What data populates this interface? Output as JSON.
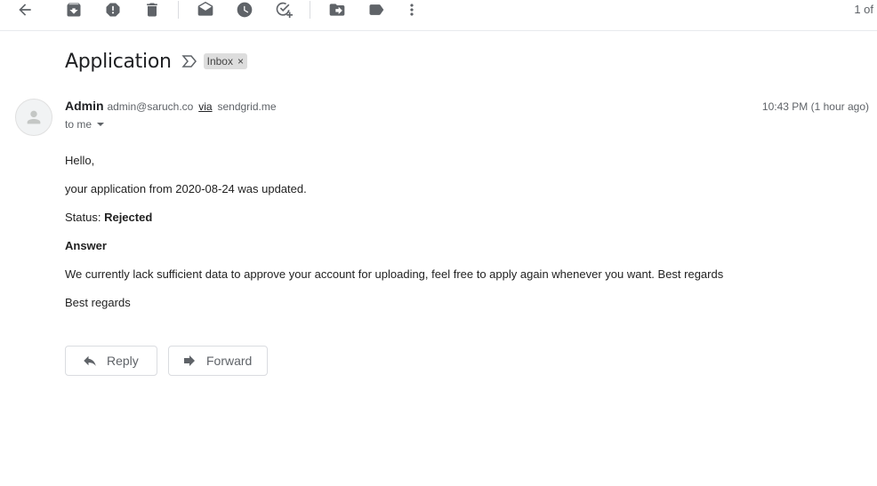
{
  "toolbar": {
    "icons": [
      "back-arrow-icon",
      "archive-icon",
      "report-spam-icon",
      "delete-icon",
      "mark-unread-icon",
      "snooze-icon",
      "add-to-tasks-icon",
      "move-to-icon",
      "label-icon",
      "more-vert-icon"
    ],
    "page_count": "1 of"
  },
  "message": {
    "subject": "Application",
    "label": "Inbox",
    "label_remove": "×",
    "sender_name": "Admin",
    "sender_email": "admin@saruch.co",
    "via_text": "via",
    "via_domain": "sendgrid.me",
    "to_text": "to me",
    "timestamp": "10:43 PM (1 hour ago)",
    "greeting": "Hello,",
    "line1": "your application from 2020-08-24 was updated.",
    "status_label": "Status: ",
    "status_value": "Rejected",
    "answer_heading": "Answer",
    "answer_text": "We currently lack sufficient data to approve your account for uploading, feel free to apply again whenever you want. Best regards",
    "signoff": "Best regards"
  },
  "actions": {
    "reply_label": "Reply",
    "forward_label": "Forward"
  }
}
